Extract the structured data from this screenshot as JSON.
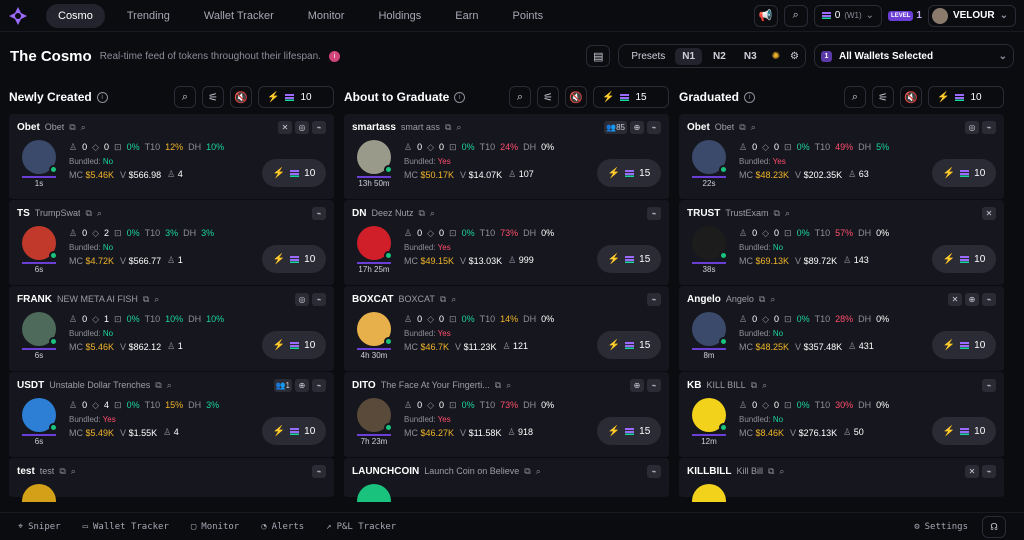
{
  "nav": {
    "tabs": [
      "Cosmo",
      "Trending",
      "Wallet Tracker",
      "Monitor",
      "Holdings",
      "Earn",
      "Points"
    ],
    "wallet_value": "0",
    "wallet_sub": "(W1)",
    "level_label": "LEVEL",
    "level": "1",
    "user": "VELOUR"
  },
  "page": {
    "title": "The Cosmo",
    "subtitle": "Real-time feed of tokens throughout their lifespan.",
    "presets_label": "Presets",
    "presets": [
      "N1",
      "N2",
      "N3"
    ],
    "wallets": "All Wallets Selected"
  },
  "columns": [
    {
      "title": "Newly Created",
      "amount": "10",
      "cards": [
        {
          "ticker": "Obet",
          "name": "Obet",
          "a": "0",
          "b": "0",
          "c": "0%",
          "t10": "12%",
          "t10c": "o",
          "dh": "10%",
          "dhc": "g",
          "bundled": "No",
          "mc": "$5.46K",
          "v": "$566.98",
          "holders": "4",
          "age": "1s",
          "buy": "10",
          "icons": [
            "x",
            "s",
            "l"
          ],
          "avatar": "#3b4a6b"
        },
        {
          "ticker": "TS",
          "name": "TrumpSwat",
          "a": "0",
          "b": "2",
          "c": "0%",
          "t10": "3%",
          "t10c": "g",
          "dh": "3%",
          "dhc": "g",
          "bundled": "No",
          "mc": "$4.72K",
          "v": "$566.77",
          "holders": "1",
          "age": "6s",
          "buy": "10",
          "icons": [
            "l"
          ],
          "avatar": "#c0392b"
        },
        {
          "ticker": "FRANK",
          "name": "NEW META AI FISH",
          "a": "0",
          "b": "1",
          "c": "0%",
          "t10": "10%",
          "t10c": "g",
          "dh": "10%",
          "dhc": "g",
          "bundled": "No",
          "mc": "$5.46K",
          "v": "$862.12",
          "holders": "1",
          "age": "6s",
          "buy": "10",
          "icons": [
            "s",
            "l"
          ],
          "avatar": "#4e6a5a"
        },
        {
          "ticker": "USDT",
          "name": "Unstable Dollar Trenches",
          "a": "0",
          "b": "4",
          "c": "0%",
          "t10": "15%",
          "t10c": "o",
          "dh": "3%",
          "dhc": "g",
          "bundled": "Yes",
          "mc": "$5.49K",
          "v": "$1.55K",
          "holders": "4",
          "age": "6s",
          "buy": "10",
          "icons": [
            "h1",
            "g",
            "l"
          ],
          "avatar": "#2d7fd6"
        },
        {
          "ticker": "test",
          "name": "test",
          "icons": [
            "l"
          ],
          "avatar": "#d4a017"
        }
      ]
    },
    {
      "title": "About to Graduate",
      "amount": "15",
      "cards": [
        {
          "ticker": "smartass",
          "name": "smart ass",
          "a": "0",
          "b": "0",
          "c": "0%",
          "t10": "24%",
          "t10c": "r",
          "dh": "0%",
          "dhc": "n",
          "bundled": "Yes",
          "mc": "$50.17K",
          "v": "$14.07K",
          "holders": "107",
          "age": "13h 50m",
          "buy": "15",
          "icons": [
            "h85",
            "g",
            "l"
          ],
          "avatar": "#9a9a8a"
        },
        {
          "ticker": "DN",
          "name": "Deez Nutz",
          "a": "0",
          "b": "0",
          "c": "0%",
          "t10": "73%",
          "t10c": "r",
          "dh": "0%",
          "dhc": "n",
          "bundled": "Yes",
          "mc": "$49.15K",
          "v": "$13.03K",
          "holders": "999",
          "age": "17h 25m",
          "buy": "15",
          "icons": [
            "l"
          ],
          "avatar": "#d11f2a"
        },
        {
          "ticker": "BOXCAT",
          "name": "BOXCAT",
          "a": "0",
          "b": "0",
          "c": "0%",
          "t10": "14%",
          "t10c": "o",
          "dh": "0%",
          "dhc": "n",
          "bundled": "Yes",
          "mc": "$46.7K",
          "v": "$11.23K",
          "holders": "121",
          "age": "4h 30m",
          "buy": "15",
          "icons": [
            "l"
          ],
          "avatar": "#e8b04a"
        },
        {
          "ticker": "DITO",
          "name": "The Face At Your Fingerti...",
          "a": "0",
          "b": "0",
          "c": "0%",
          "t10": "73%",
          "t10c": "r",
          "dh": "0%",
          "dhc": "n",
          "bundled": "Yes",
          "mc": "$46.27K",
          "v": "$11.58K",
          "holders": "918",
          "age": "7h 23m",
          "buy": "15",
          "icons": [
            "g",
            "l"
          ],
          "avatar": "#5a4a3a"
        },
        {
          "ticker": "LAUNCHCOIN",
          "name": "Launch Coin on Believe",
          "icons": [
            "l"
          ],
          "avatar": "#19c37d"
        }
      ]
    },
    {
      "title": "Graduated",
      "amount": "10",
      "cards": [
        {
          "ticker": "Obet",
          "name": "Obet",
          "a": "0",
          "b": "0",
          "c": "0%",
          "t10": "49%",
          "t10c": "r",
          "dh": "5%",
          "dhc": "g",
          "bundled": "Yes",
          "mc": "$48.23K",
          "v": "$202.35K",
          "holders": "63",
          "age": "22s",
          "buy": "10",
          "icons": [
            "s",
            "l"
          ],
          "avatar": "#3b4a6b"
        },
        {
          "ticker": "TRUST",
          "name": "TrustExam",
          "a": "0",
          "b": "0",
          "c": "0%",
          "t10": "57%",
          "t10c": "r",
          "dh": "0%",
          "dhc": "n",
          "bundled": "No",
          "mc": "$69.13K",
          "v": "$89.72K",
          "holders": "143",
          "age": "38s",
          "buy": "10",
          "icons": [
            "x"
          ],
          "avatar": "#1c1c1c"
        },
        {
          "ticker": "Angelo",
          "name": "Angelo",
          "a": "0",
          "b": "0",
          "c": "0%",
          "t10": "28%",
          "t10c": "r",
          "dh": "0%",
          "dhc": "n",
          "bundled": "No",
          "mc": "$48.25K",
          "v": "$357.48K",
          "holders": "431",
          "age": "8m",
          "buy": "10",
          "icons": [
            "x",
            "g",
            "l"
          ],
          "avatar": "#3b4a6b"
        },
        {
          "ticker": "KB",
          "name": "KILL BILL",
          "a": "0",
          "b": "0",
          "c": "0%",
          "t10": "30%",
          "t10c": "r",
          "dh": "0%",
          "dhc": "n",
          "bundled": "No",
          "mc": "$8.46K",
          "v": "$276.13K",
          "holders": "50",
          "age": "12m",
          "buy": "10",
          "icons": [
            "l"
          ],
          "avatar": "#f2d21a"
        },
        {
          "ticker": "KILLBILL",
          "name": "Kill Bill",
          "icons": [
            "x",
            "l"
          ],
          "avatar": "#f2d21a"
        }
      ]
    }
  ],
  "bottom": {
    "items": [
      "Sniper",
      "Wallet Tracker",
      "Monitor",
      "Alerts",
      "P&L Tracker"
    ],
    "settings": "Settings"
  },
  "labels": {
    "t10": "T10",
    "dh": "DH",
    "bundled": "Bundled:",
    "mc": "MC",
    "v": "V"
  }
}
